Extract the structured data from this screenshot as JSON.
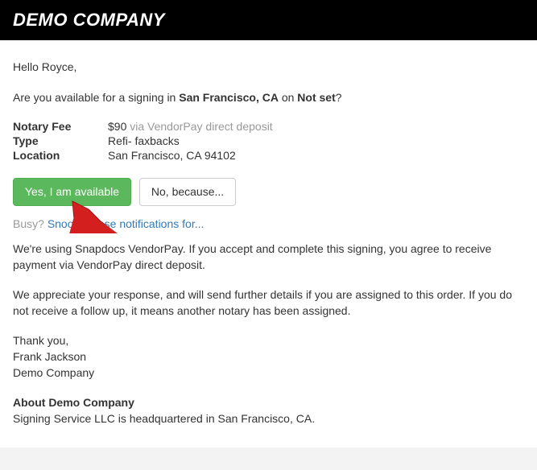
{
  "header": {
    "company": "DEMO COMPANY"
  },
  "greeting": "Hello Royce,",
  "availability": {
    "prefix": "Are you available for a signing in ",
    "city": "San Francisco, CA",
    "mid": " on ",
    "when": "Not set",
    "suffix": "?"
  },
  "details": {
    "fee_label": "Notary Fee",
    "fee_value": "$90",
    "fee_note": " via VendorPay direct deposit",
    "type_label": "Type",
    "type_value": "Refi- faxbacks",
    "location_label": "Location",
    "location_value": "San Francisco, CA 94102"
  },
  "buttons": {
    "yes": "Yes, I am available",
    "no": "No, because..."
  },
  "snooze": {
    "busy": "Busy? ",
    "link": "Snooze these notifications for..."
  },
  "body1": "We're using Snapdocs VendorPay. If you accept and complete this signing, you agree to receive payment via VendorPay direct deposit.",
  "body2": "We appreciate your response, and will send further details if you are assigned to this order. If you do not receive a follow up, it means another notary has been assigned.",
  "signoff": {
    "thank": "Thank you,",
    "name": "Frank Jackson",
    "company": "Demo Company"
  },
  "about": {
    "heading": "About Demo Company",
    "text": "Signing Service LLC is headquartered in San Francisco, CA."
  }
}
